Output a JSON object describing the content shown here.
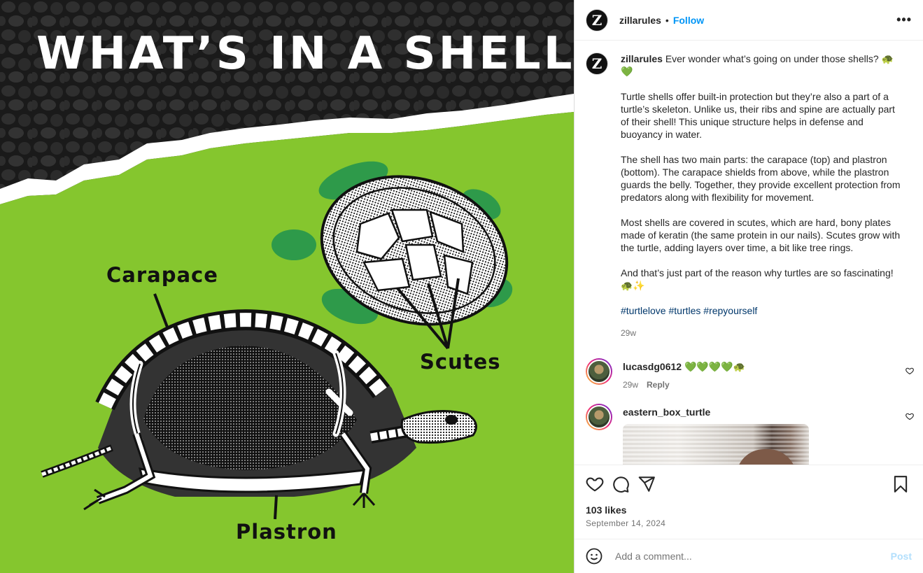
{
  "post_image": {
    "headline": "WHAT’S IN A SHELL?",
    "labels": {
      "carapace": "Carapace",
      "scutes": "Scutes",
      "plastron": "Plastron"
    }
  },
  "header": {
    "username": "zillarules",
    "separator": "•",
    "follow_label": "Follow",
    "more_icon": "more-horizontal-icon",
    "avatar_letter": "Z"
  },
  "caption": {
    "username": "zillarules",
    "first_line": "Ever wonder what’s going on under those shells? 🐢💚",
    "paragraphs": [
      "Turtle shells offer built-in protection but they’re also a part of a turtle’s skeleton. Unlike us, their ribs and spine are actually part of their shell! This unique structure helps in defense and buoyancy in water.",
      "The shell has two main parts: the carapace (top) and plastron (bottom). The carapace shields from above, while the plastron guards the belly. Together, they provide excellent protection from predators along with flexibility for movement.",
      "Most shells are covered in scutes, which are hard, bony plates made of keratin (the same protein in our nails). Scutes grow with the turtle, adding layers over time, a bit like tree rings.",
      "And that’s just part of the reason why turtles are so fascinating! 🐢✨"
    ],
    "hashtags": "#turtlelove #turtles #repyourself",
    "time": "29w"
  },
  "comments": [
    {
      "username": "lucasdg0612",
      "text": "💚💚💚💚🐢",
      "time": "29w",
      "reply_label": "Reply"
    },
    {
      "username": "eastern_box_turtle",
      "text": ""
    }
  ],
  "actions": {
    "likes": "103 likes",
    "date": "September 14, 2024"
  },
  "add_comment": {
    "placeholder": "Add a comment...",
    "post_label": "Post"
  },
  "colors": {
    "accent": "#0095f6",
    "hashtag": "#00376b",
    "image_green": "#85c62e"
  }
}
